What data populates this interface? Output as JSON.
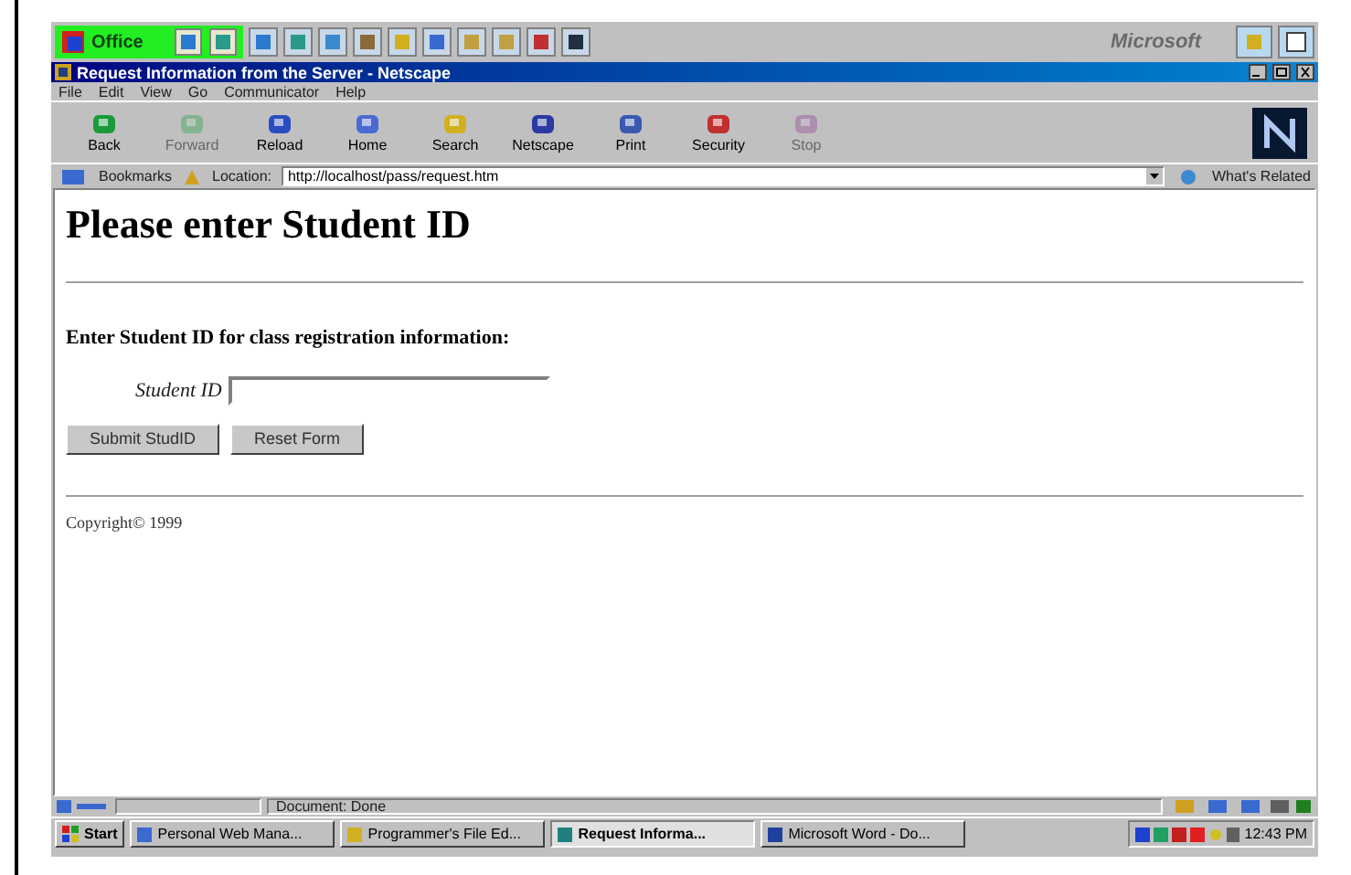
{
  "office_bar": {
    "label": "Office",
    "brand": "Microsoft"
  },
  "window": {
    "title": "Request Information from the Server - Netscape"
  },
  "menu": [
    "File",
    "Edit",
    "View",
    "Go",
    "Communicator",
    "Help"
  ],
  "toolbar": [
    {
      "label": "Back",
      "disabled": false
    },
    {
      "label": "Forward",
      "disabled": true
    },
    {
      "label": "Reload",
      "disabled": false
    },
    {
      "label": "Home",
      "disabled": false
    },
    {
      "label": "Search",
      "disabled": false
    },
    {
      "label": "Netscape",
      "disabled": false
    },
    {
      "label": "Print",
      "disabled": false
    },
    {
      "label": "Security",
      "disabled": false
    },
    {
      "label": "Stop",
      "disabled": true
    }
  ],
  "location_bar": {
    "bookmarks": "Bookmarks",
    "location_label": "Location:",
    "url": "http://localhost/pass/request.htm",
    "related": "What's Related"
  },
  "page": {
    "heading": "Please enter Student ID",
    "intro": "Enter Student ID for class registration information:",
    "field_label": "Student ID",
    "buttons": [
      "Submit StudID",
      "Reset Form"
    ],
    "footer": "Copyright© 1999"
  },
  "status_bar": {
    "text": "Document: Done"
  },
  "taskbar": {
    "start": "Start",
    "items": [
      {
        "label": "Personal Web Mana...",
        "selected": false
      },
      {
        "label": "Programmer's File Ed...",
        "selected": false
      },
      {
        "label": "Request Informa...",
        "selected": true
      },
      {
        "label": "Microsoft Word - Do...",
        "selected": false
      }
    ],
    "clock": "12:43 PM"
  }
}
